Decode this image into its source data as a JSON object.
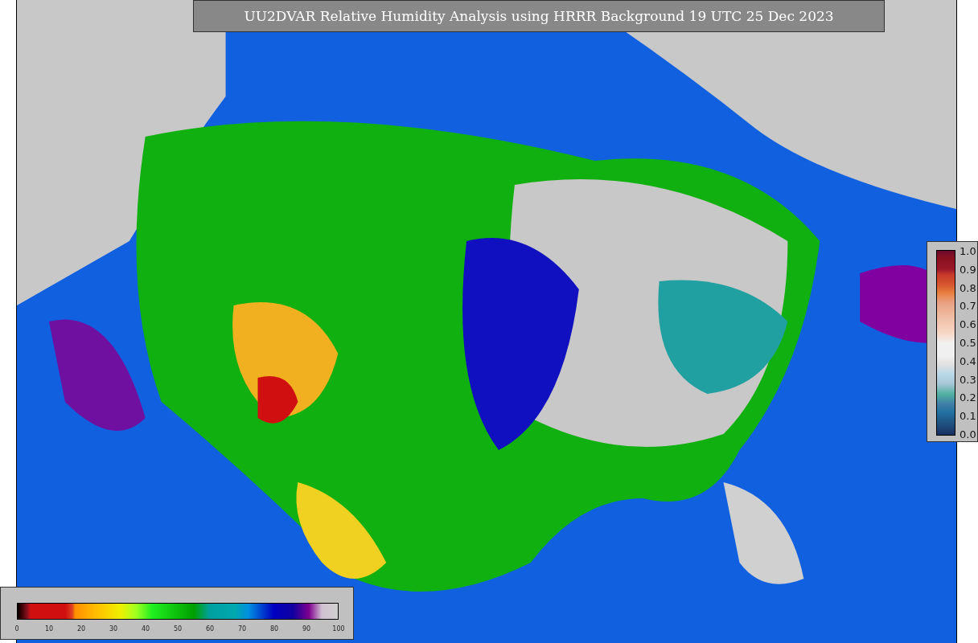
{
  "title": "UU2DVAR Relative Humidity Analysis using HRRR Background 19 UTC 25 Dec 2023",
  "humidity_colorbar": {
    "ticks": [
      "0",
      "10",
      "20",
      "30",
      "40",
      "50",
      "60",
      "70",
      "80",
      "90",
      "100"
    ]
  },
  "station_colorbar": {
    "ticks": [
      "1.0",
      "0.9",
      "0.8",
      "0.7",
      "0.6",
      "0.5",
      "0.4",
      "0.3",
      "0.2",
      "0.1",
      "0.0"
    ]
  }
}
